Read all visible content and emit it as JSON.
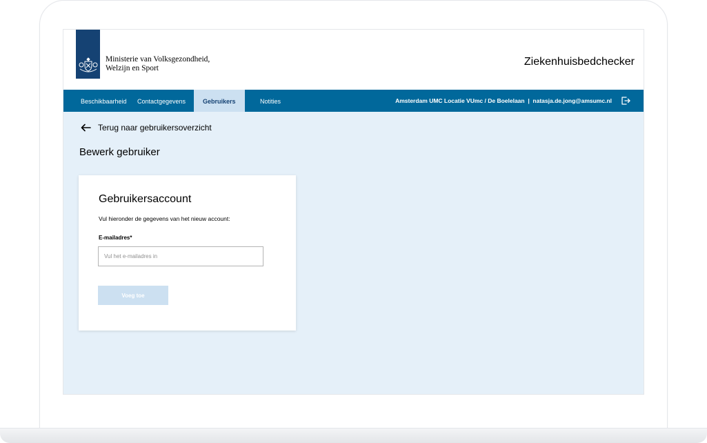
{
  "header": {
    "ministry_line1": "Ministerie van Volksgezondheid,",
    "ministry_line2": "Welzijn en Sport",
    "app_title": "Ziekenhuisbedchecker"
  },
  "nav": {
    "items": [
      {
        "label": "Beschikbaarheid",
        "active": false
      },
      {
        "label": "Contactgegevens",
        "active": false
      },
      {
        "label": "Gebruikers",
        "active": true
      },
      {
        "label": "Notities",
        "active": false
      }
    ],
    "user_info": "Amsterdam UMC Locatie VUmc / De Boelelaan  |  natasja.de.jong@amsumc.nl",
    "logout_icon": "logout-icon"
  },
  "main": {
    "back_link": "Terug naar gebruikersoverzicht",
    "page_title": "Bewerk gebruiker",
    "card": {
      "title": "Gebruikersaccount",
      "description": "Vul hieronder de gegevens van het nieuw account:",
      "email_label": "E-mailadres*",
      "email_value": "",
      "email_placeholder": "Vul het e-mailadres in",
      "submit_label": "Voeg toe"
    }
  },
  "colors": {
    "navbar": "#01689b",
    "active_tab": "#cce0f1",
    "logo_bar": "#154273",
    "content_bg": "#e5f0f9",
    "button_disabled": "#cce0f1"
  }
}
